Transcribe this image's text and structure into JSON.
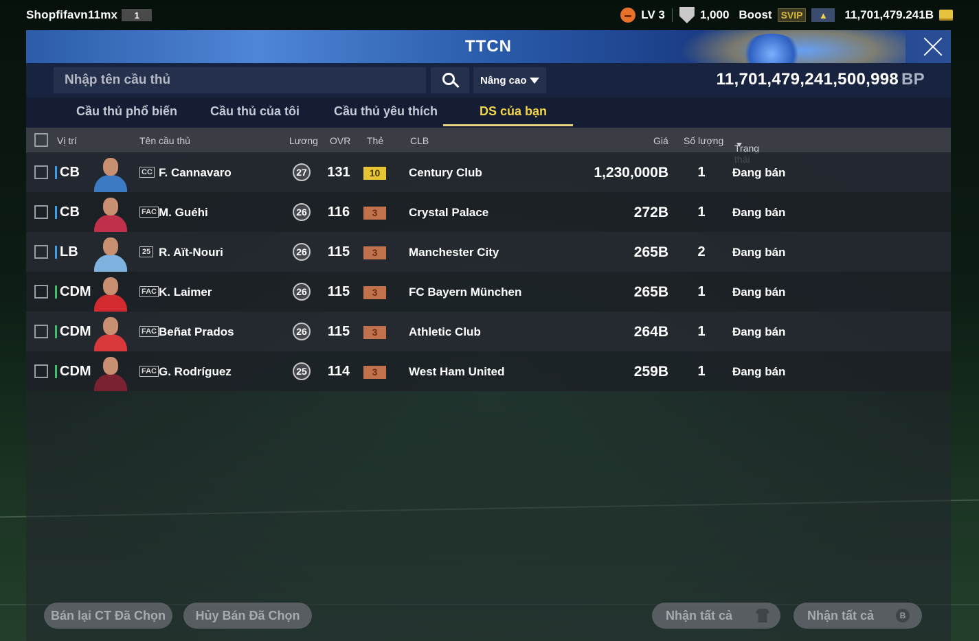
{
  "topbar": {
    "username": "Shopfifavn11mx",
    "user_badge": "1",
    "level": "LV 3",
    "points": "1,000",
    "boost_label": "Boost",
    "svip_label": "SVIP",
    "coin_balance": "11,701,479.241B"
  },
  "panel": {
    "title": "TTCN",
    "search_placeholder": "Nhập tên cầu thủ",
    "advanced_label": "Nâng cao",
    "bp_balance": "11,701,479,241,500,998",
    "bp_unit": "BP"
  },
  "tabs": [
    {
      "label": "Cầu thủ phổ biến"
    },
    {
      "label": "Cầu thủ của tôi"
    },
    {
      "label": "Cầu thủ yêu thích"
    },
    {
      "label": "DS của bạn"
    }
  ],
  "columns": {
    "position": "Vị trí",
    "name": "Tên cầu thủ",
    "wage": "Lương",
    "ovr": "OVR",
    "card": "Thẻ",
    "club": "CLB",
    "price": "Giá",
    "quantity": "Số lượng",
    "status": "Trạng thái"
  },
  "players": [
    {
      "position": "CB",
      "pos_color": "#3a9ee8",
      "season": "CC",
      "name": "F. Cannavaro",
      "wage": "27",
      "ovr": "131",
      "grade": "10",
      "grade_type": "gold",
      "club": "Century Club",
      "price": "1,230,000B",
      "quantity": "1",
      "status": "Đang bán",
      "kit_color": "#3d7ac4"
    },
    {
      "position": "CB",
      "pos_color": "#3a9ee8",
      "season": "FAC",
      "name": "M. Guéhi",
      "wage": "26",
      "ovr": "116",
      "grade": "3",
      "grade_type": "bronze",
      "club": "Crystal Palace",
      "price": "272B",
      "quantity": "1",
      "status": "Đang bán",
      "kit_color": "#c0304a"
    },
    {
      "position": "LB",
      "pos_color": "#3a9ee8",
      "season": "25",
      "name": "R. Aït-Nouri",
      "wage": "26",
      "ovr": "115",
      "grade": "3",
      "grade_type": "bronze",
      "club": "Manchester City",
      "price": "265B",
      "quantity": "2",
      "status": "Đang bán",
      "kit_color": "#7fb2df"
    },
    {
      "position": "CDM",
      "pos_color": "#3cc26a",
      "season": "FAC",
      "name": "K. Laimer",
      "wage": "26",
      "ovr": "115",
      "grade": "3",
      "grade_type": "bronze",
      "club": "FC Bayern München",
      "price": "265B",
      "quantity": "1",
      "status": "Đang bán",
      "kit_color": "#d22a2f"
    },
    {
      "position": "CDM",
      "pos_color": "#3cc26a",
      "season": "FAC",
      "name": "Beñat Prados",
      "wage": "26",
      "ovr": "115",
      "grade": "3",
      "grade_type": "bronze",
      "club": "Athletic Club",
      "price": "264B",
      "quantity": "1",
      "status": "Đang bán",
      "kit_color": "#d8383a"
    },
    {
      "position": "CDM",
      "pos_color": "#3cc26a",
      "season": "FAC",
      "name": "G. Rodríguez",
      "wage": "25",
      "ovr": "114",
      "grade": "3",
      "grade_type": "bronze",
      "club": "West Ham United",
      "price": "259B",
      "quantity": "1",
      "status": "Đang bán",
      "kit_color": "#7a2231"
    }
  ],
  "footer": {
    "resell_selected": "Bán lại CT Đã Chọn",
    "cancel_selected": "Hủy Bán Đã Chọn",
    "claim_all_players": "Nhận tất cả",
    "claim_all_bp": "Nhận tất cả",
    "bp_symbol": "B"
  }
}
